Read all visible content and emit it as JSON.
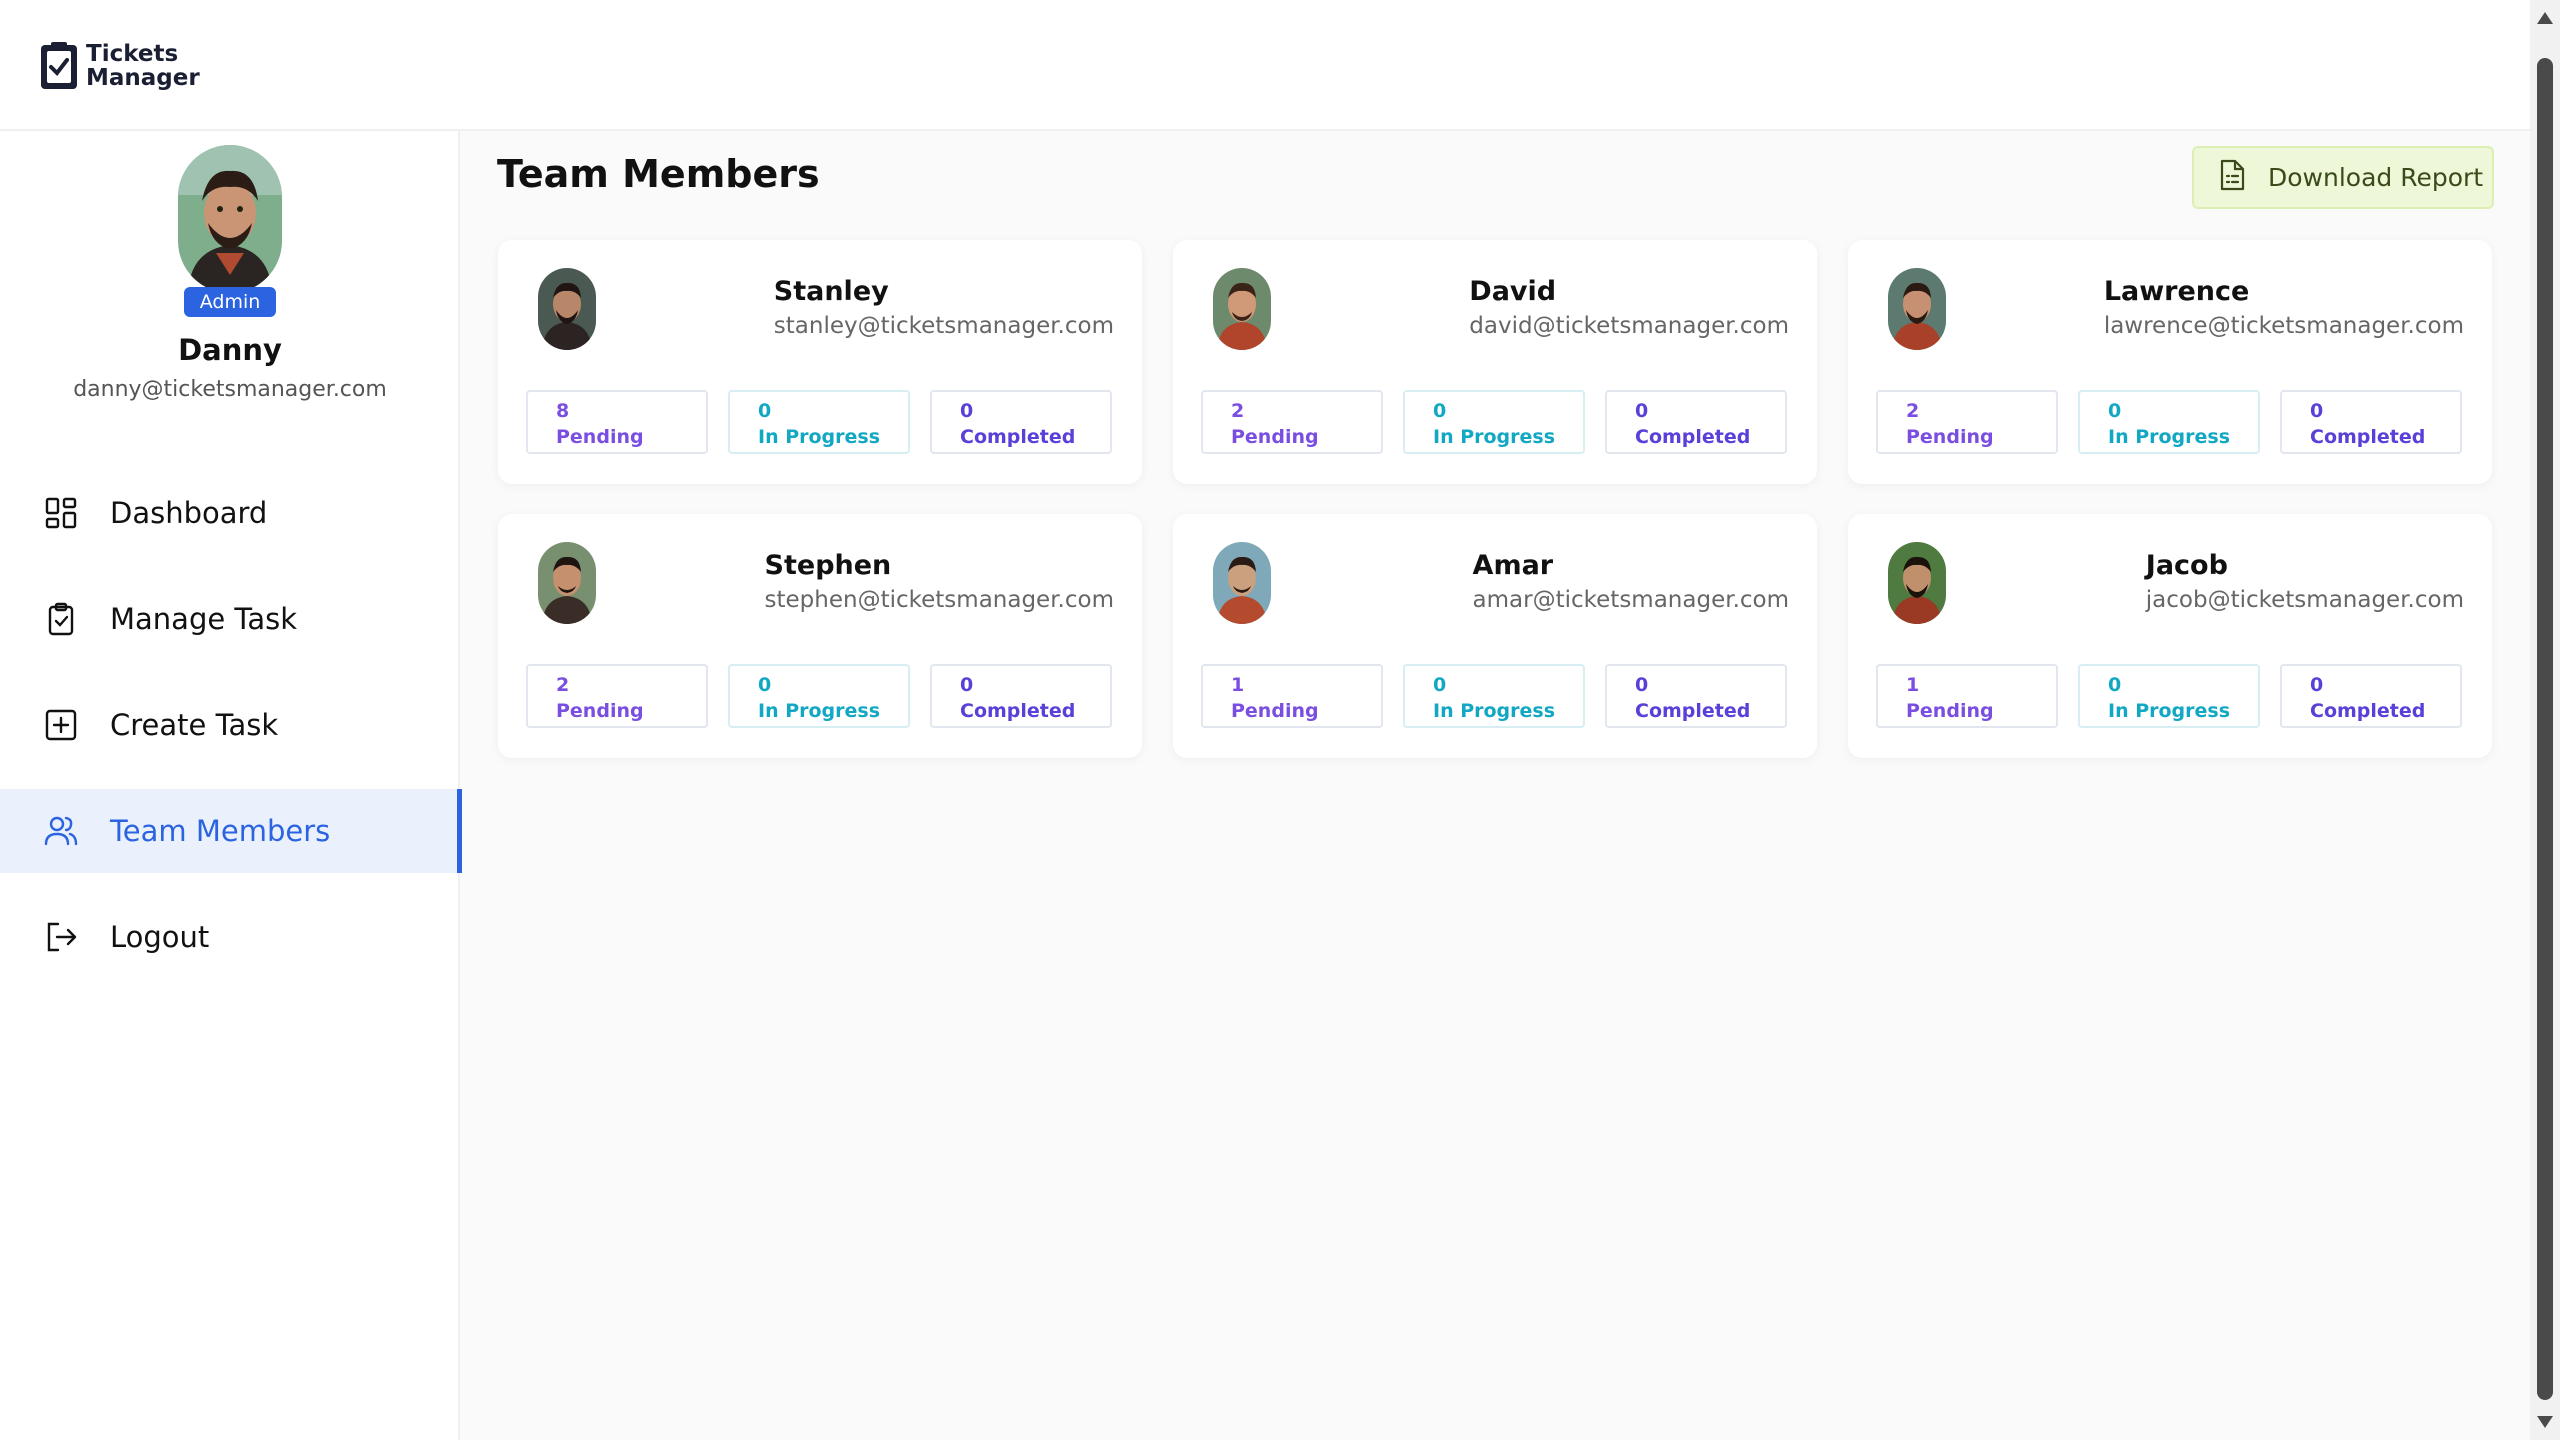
{
  "app": {
    "title_line1": "Tickets",
    "title_line2": "Manager"
  },
  "profile": {
    "role": "Admin",
    "name": "Danny",
    "email": "danny@ticketsmanager.com"
  },
  "nav": [
    {
      "label": "Dashboard",
      "icon": "dashboard-icon"
    },
    {
      "label": "Manage Task",
      "icon": "clipboard-check-icon"
    },
    {
      "label": "Create Task",
      "icon": "plus-square-icon"
    },
    {
      "label": "Team Members",
      "icon": "users-icon",
      "active": true
    },
    {
      "label": "Logout",
      "icon": "logout-icon"
    }
  ],
  "page": {
    "title": "Team Members",
    "download_label": "Download Report"
  },
  "members": [
    {
      "name": "Stanley",
      "email": "stanley@ticketsmanager.com",
      "pending": "8",
      "in_progress": "0",
      "completed": "0"
    },
    {
      "name": "David",
      "email": "david@ticketsmanager.com",
      "pending": "2",
      "in_progress": "0",
      "completed": "0"
    },
    {
      "name": "Lawrence",
      "email": "lawrence@ticketsmanager.com",
      "pending": "2",
      "in_progress": "0",
      "completed": "0"
    },
    {
      "name": "Stephen",
      "email": "stephen@ticketsmanager.com",
      "pending": "2",
      "in_progress": "0",
      "completed": "0"
    },
    {
      "name": "Amar",
      "email": "amar@ticketsmanager.com",
      "pending": "1",
      "in_progress": "0",
      "completed": "0"
    },
    {
      "name": "Jacob",
      "email": "jacob@ticketsmanager.com",
      "pending": "1",
      "in_progress": "0",
      "completed": "0"
    }
  ],
  "stat_labels": {
    "pending": "Pending",
    "in_progress": "In Progress",
    "completed": "Completed"
  },
  "colors": {
    "accent": "#2b63e0",
    "pending": "#7a4ee0",
    "in_progress": "#12a8c4",
    "completed": "#5a3fd8"
  }
}
